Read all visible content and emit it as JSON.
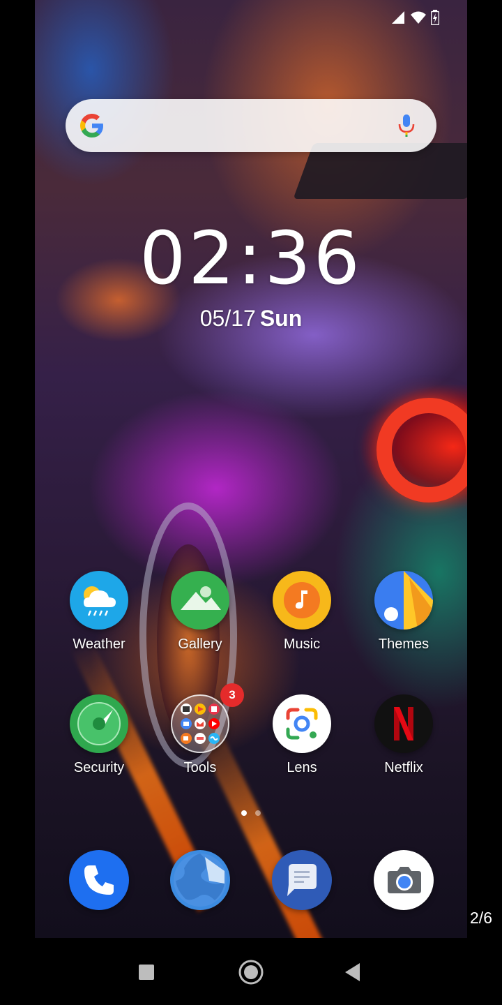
{
  "status": {
    "icons": [
      "cell-signal-icon",
      "wifi-icon",
      "battery-charging-icon"
    ]
  },
  "search": {
    "logo": "google-g-icon",
    "mic": "microphone-icon",
    "colors": {
      "blue": "#4285F4",
      "red": "#EA4335",
      "yellow": "#FBBC05",
      "green": "#34A853"
    }
  },
  "clock": {
    "time": "02:36",
    "date": "05/17",
    "weekday": "Sun"
  },
  "apps": {
    "row1": [
      {
        "label": "Weather",
        "icon": "weather-icon"
      },
      {
        "label": "Gallery",
        "icon": "gallery-icon"
      },
      {
        "label": "Music",
        "icon": "music-icon"
      },
      {
        "label": "Themes",
        "icon": "themes-icon"
      }
    ],
    "row2": [
      {
        "label": "Security",
        "icon": "security-icon"
      },
      {
        "label": "Tools",
        "icon": "tools-folder-icon",
        "badge": "3"
      },
      {
        "label": "Lens",
        "icon": "lens-icon"
      },
      {
        "label": "Netflix",
        "icon": "netflix-icon"
      }
    ]
  },
  "pages": {
    "total": 2,
    "current": 1
  },
  "dock": [
    {
      "icon": "phone-icon"
    },
    {
      "icon": "browser-icon"
    },
    {
      "icon": "messages-icon"
    },
    {
      "icon": "camera-icon"
    }
  ],
  "overlay": {
    "counter": "2/6"
  },
  "navbar": {
    "buttons": [
      "recents-button",
      "home-button",
      "back-button"
    ]
  }
}
